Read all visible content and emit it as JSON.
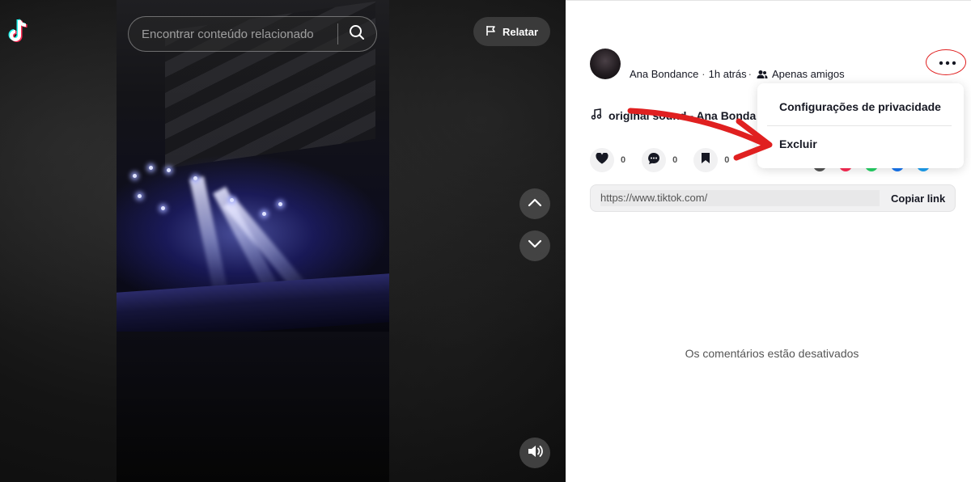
{
  "search": {
    "placeholder": "Encontrar conteúdo relacionado"
  },
  "report_button": {
    "label": "Relatar"
  },
  "post": {
    "author": "Ana Bondance",
    "time": "1h atrás",
    "separator": "·",
    "privacy": "Apenas amigos",
    "sound": "original sound - Ana Bonda"
  },
  "actions": {
    "likes": "0",
    "comments": "0",
    "saves": "0"
  },
  "link": {
    "url": "https://www.tiktok.com/",
    "copy_label": "Copiar link"
  },
  "comments_disabled": "Os comentários estão desativados",
  "menu": {
    "items": [
      {
        "label": "Configurações de privacidade"
      },
      {
        "label": "Excluir"
      }
    ]
  },
  "icons": {
    "logo": "tiktok-logo",
    "search": "search-icon",
    "report": "flag-icon",
    "up": "chevron-up-icon",
    "down": "chevron-down-icon",
    "volume": "volume-icon",
    "more": "more-icon",
    "music": "music-note-icon",
    "like": "heart-icon",
    "comment": "comment-icon",
    "save": "bookmark-icon",
    "friends": "friends-icon"
  },
  "colors": {
    "annotation_red": "#e02020",
    "text_primary": "#161823",
    "tiktok_cyan": "#25f4ee",
    "tiktok_red": "#fe2c55"
  }
}
